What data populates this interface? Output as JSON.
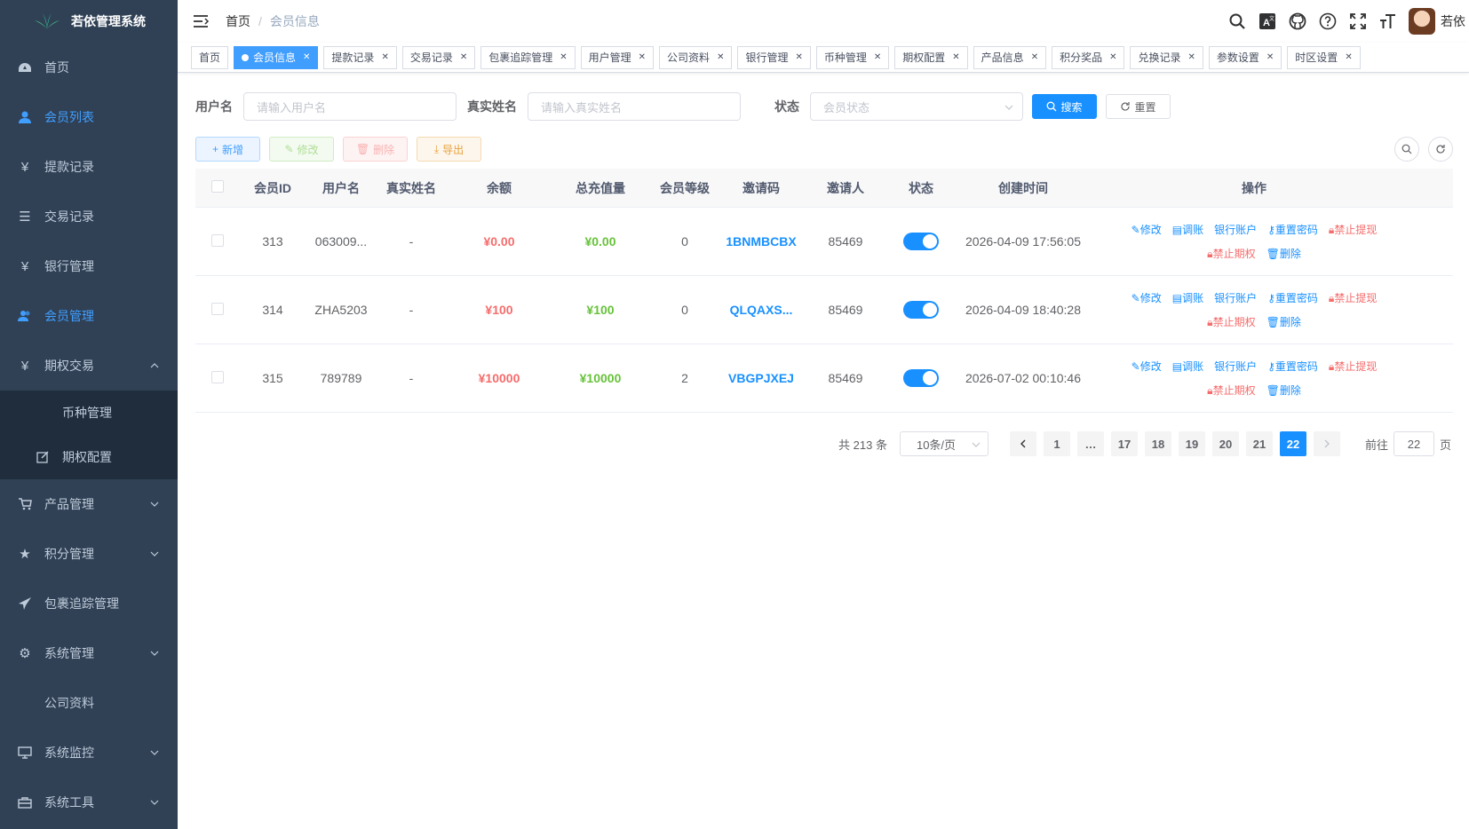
{
  "app": {
    "title": "若依管理系统"
  },
  "sidebar": {
    "items": [
      {
        "label": "首页",
        "icon": "dashboard-icon"
      },
      {
        "label": "会员列表",
        "icon": "user-icon",
        "active": true
      },
      {
        "label": "提款记录",
        "icon": "yen-icon"
      },
      {
        "label": "交易记录",
        "icon": "list-icon"
      },
      {
        "label": "银行管理",
        "icon": "yen-icon"
      },
      {
        "label": "会员管理",
        "icon": "peoples-icon",
        "active": true
      },
      {
        "label": "期权交易",
        "icon": "yen-icon",
        "expanded": true
      },
      {
        "label": "币种管理"
      },
      {
        "label": "期权配置",
        "icon": "edit-icon"
      },
      {
        "label": "产品管理",
        "icon": "cart-icon"
      },
      {
        "label": "积分管理",
        "icon": "star-icon"
      },
      {
        "label": "包裹追踪管理",
        "icon": "send-icon"
      },
      {
        "label": "系统管理",
        "icon": "gear-icon"
      },
      {
        "label": "公司资料"
      },
      {
        "label": "系统监控",
        "icon": "monitor-icon"
      },
      {
        "label": "系统工具",
        "icon": "toolbox-icon"
      }
    ]
  },
  "navbar": {
    "breadcrumb_home": "首页",
    "breadcrumb_sep": "/",
    "breadcrumb_current": "会员信息",
    "username": "若依"
  },
  "tags": [
    "首页",
    "会员信息",
    "提款记录",
    "交易记录",
    "包裹追踪管理",
    "用户管理",
    "公司资料",
    "银行管理",
    "币种管理",
    "期权配置",
    "产品信息",
    "积分奖品",
    "兑换记录",
    "参数设置",
    "时区设置"
  ],
  "search": {
    "username_label": "用户名",
    "username_placeholder": "请输入用户名",
    "realname_label": "真实姓名",
    "realname_placeholder": "请输入真实姓名",
    "status_label": "状态",
    "status_placeholder": "会员状态",
    "search_btn": "搜索",
    "reset_btn": "重置"
  },
  "toolbar": {
    "add": "新增",
    "edit": "修改",
    "delete": "删除",
    "export": "导出"
  },
  "table": {
    "headers": [
      "会员ID",
      "用户名",
      "真实姓名",
      "余额",
      "总充值量",
      "会员等级",
      "邀请码",
      "邀请人",
      "状态",
      "创建时间",
      "操作"
    ],
    "rows": [
      {
        "id": "313",
        "username": "063009...",
        "realname": "-",
        "balance": "¥0.00",
        "total": "¥0.00",
        "level": "0",
        "code": "1BNMBCBX",
        "inviter": "85469",
        "created": "2026-04-09 17:56:05"
      },
      {
        "id": "314",
        "username": "ZHA5203",
        "realname": "-",
        "balance": "¥100",
        "total": "¥100",
        "level": "0",
        "code": "QLQAXS...",
        "inviter": "85469",
        "created": "2026-04-09 18:40:28"
      },
      {
        "id": "315",
        "username": "789789",
        "realname": "-",
        "balance": "¥10000",
        "total": "¥10000",
        "level": "2",
        "code": "VBGPJXEJ",
        "inviter": "85469",
        "created": "2026-07-02 00:10:46"
      }
    ],
    "ops": {
      "edit": "修改",
      "adjust": "调账",
      "bank": "银行账户",
      "reset_pwd": "重置密码",
      "ban_withdraw": "禁止提现",
      "ban_option": "禁止期权",
      "delete": "删除"
    }
  },
  "pagination": {
    "total": "共 213 条",
    "page_size": "10条/页",
    "pages": [
      "1",
      "…",
      "17",
      "18",
      "19",
      "20",
      "21",
      "22"
    ],
    "current": "22",
    "goto_label": "前往",
    "goto_value": "22",
    "page_suffix": "页"
  },
  "colors": {
    "sidebar_bg": "#304156",
    "primary": "#1890ff",
    "danger": "#f56c6c",
    "success": "#67c23a"
  }
}
